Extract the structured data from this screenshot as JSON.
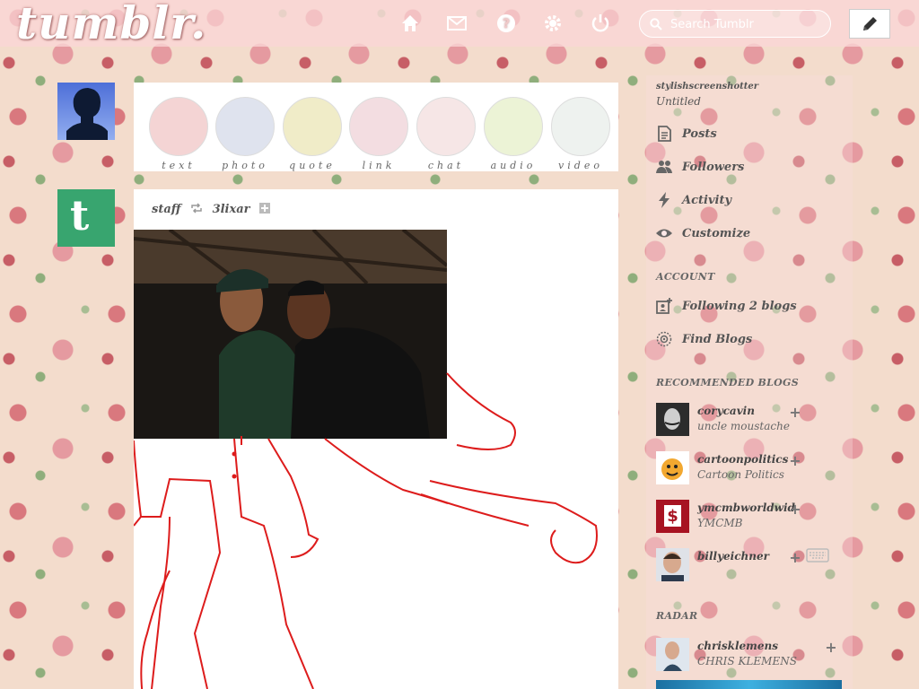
{
  "header": {
    "logo": "tumblr.",
    "search_placeholder": "Search Tumblr",
    "nav_icons": [
      "home-icon",
      "mail-icon",
      "help-icon",
      "settings-icon",
      "power-icon"
    ]
  },
  "post_types": [
    {
      "label": "text",
      "color": "#f4d4d4"
    },
    {
      "label": "photo",
      "color": "#dfe3ee"
    },
    {
      "label": "quote",
      "color": "#f0ecc8"
    },
    {
      "label": "link",
      "color": "#f3dde1"
    },
    {
      "label": "chat",
      "color": "#f6e6e6"
    },
    {
      "label": "audio",
      "color": "#ecf3d6"
    },
    {
      "label": "video",
      "color": "#eef2ef"
    }
  ],
  "post": {
    "author": "staff",
    "reblogged_from": "3lixar"
  },
  "sidebar": {
    "blog_name": "stylishscreenshotter",
    "blog_title": "Untitled",
    "menu": [
      {
        "label": "Posts",
        "icon": "posts-icon"
      },
      {
        "label": "Followers",
        "icon": "followers-icon"
      },
      {
        "label": "Activity",
        "icon": "activity-icon"
      },
      {
        "label": "Customize",
        "icon": "eye-icon"
      }
    ],
    "account_header": "ACCOUNT",
    "account_menu": [
      {
        "label": "Following 2 blogs",
        "icon": "following-icon"
      },
      {
        "label": "Find Blogs",
        "icon": "compass-icon"
      }
    ],
    "recommended_header": "RECOMMENDED BLOGS",
    "recommended": [
      {
        "name": "corycavin",
        "subtitle": "uncle moustache",
        "color": "#333333"
      },
      {
        "name": "cartoonpolitics",
        "subtitle": "Cartoon Politics",
        "color": "#f2a830"
      },
      {
        "name": "ymcmbworldwid",
        "subtitle": "YMCMB",
        "color": "#c3192a"
      },
      {
        "name": "billyeichner",
        "subtitle": "",
        "color": "#6b7f99"
      }
    ],
    "radar_header": "RADAR",
    "radar": {
      "name": "chrisklemens",
      "subtitle": "CHRIS KLEMENS",
      "color": "#2f4860"
    }
  }
}
